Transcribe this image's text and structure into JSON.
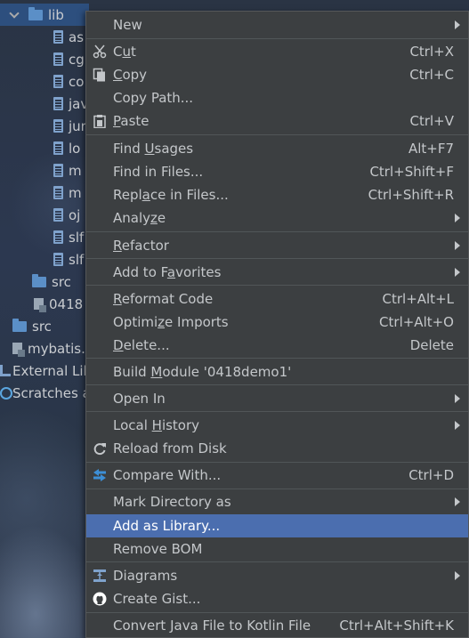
{
  "tree": {
    "items": [
      {
        "label": "lib"
      },
      {
        "label": "as"
      },
      {
        "label": "cg"
      },
      {
        "label": "co"
      },
      {
        "label": "jav"
      },
      {
        "label": "jur"
      },
      {
        "label": "lo"
      },
      {
        "label": "m"
      },
      {
        "label": "m"
      },
      {
        "label": "oj"
      },
      {
        "label": "slf"
      },
      {
        "label": "slf"
      },
      {
        "label": "src"
      },
      {
        "label": "0418"
      },
      {
        "label": "src"
      },
      {
        "label": "mybatis."
      },
      {
        "label": "External Lib"
      },
      {
        "label": "Scratches a"
      }
    ]
  },
  "menu": {
    "new": {
      "label": "New"
    },
    "cut": {
      "pre": "C",
      "u": "u",
      "post": "t",
      "shortcut": "Ctrl+X"
    },
    "copy": {
      "pre": "",
      "u": "C",
      "post": "opy",
      "shortcut": "Ctrl+C"
    },
    "copy_path": {
      "label": "Copy Path..."
    },
    "paste": {
      "pre": "",
      "u": "P",
      "post": "aste",
      "shortcut": "Ctrl+V"
    },
    "find_usages": {
      "pre": "Find ",
      "u": "U",
      "post": "sages",
      "shortcut": "Alt+F7"
    },
    "find_in_files": {
      "label": "Find in Files...",
      "shortcut": "Ctrl+Shift+F"
    },
    "replace_in_files": {
      "pre": "Repl",
      "u": "a",
      "post": "ce in Files...",
      "shortcut": "Ctrl+Shift+R"
    },
    "analyze": {
      "pre": "Analy",
      "u": "z",
      "post": "e"
    },
    "refactor": {
      "pre": "",
      "u": "R",
      "post": "efactor"
    },
    "add_to_favorites": {
      "pre": "Add to F",
      "u": "a",
      "post": "vorites"
    },
    "reformat_code": {
      "pre": "",
      "u": "R",
      "post": "eformat Code",
      "shortcut": "Ctrl+Alt+L"
    },
    "optimize_imports": {
      "pre": "Optimi",
      "u": "z",
      "post": "e Imports",
      "shortcut": "Ctrl+Alt+O"
    },
    "delete": {
      "pre": "",
      "u": "D",
      "post": "elete...",
      "shortcut": "Delete"
    },
    "build_module": {
      "pre": "Build ",
      "u": "M",
      "post": "odule '0418demo1'"
    },
    "open_in": {
      "label": "Open In"
    },
    "local_history": {
      "pre": "Local ",
      "u": "H",
      "post": "istory"
    },
    "reload_from_disk": {
      "label": "Reload from Disk"
    },
    "compare_with": {
      "label": "Compare With...",
      "shortcut": "Ctrl+D"
    },
    "mark_directory_as": {
      "label": "Mark Directory as"
    },
    "add_as_library": {
      "label": "Add as Library..."
    },
    "remove_bom": {
      "label": "Remove BOM"
    },
    "diagrams": {
      "label": "Diagrams"
    },
    "create_gist": {
      "label": "Create Gist..."
    },
    "convert_java": {
      "label": "Convert Java File to Kotlin File",
      "shortcut": "Ctrl+Alt+Shift+K"
    }
  },
  "colors": {
    "menu_bg": "#3c3f41",
    "highlight": "#4b6eaf",
    "text": "#c4c7ca"
  }
}
